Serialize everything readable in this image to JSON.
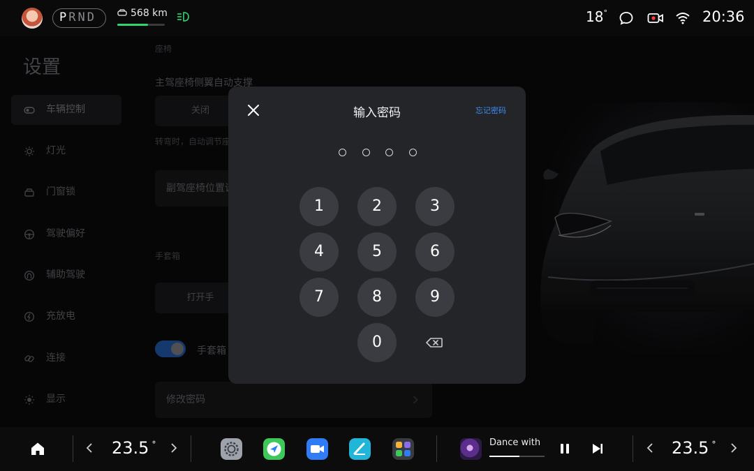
{
  "status_bar": {
    "gear": {
      "active": "P",
      "rest": "RND"
    },
    "range": "568 km",
    "range_level_percent": 65,
    "temperature": "18",
    "temperature_unit": "°",
    "time": "20:36",
    "icons": [
      "avatar",
      "car-icon",
      "headlight-icon",
      "message-icon",
      "camera-icon",
      "wifi-icon"
    ]
  },
  "settings": {
    "title": "设置",
    "nav": [
      {
        "label": "车辆控制",
        "icon": "car-control-icon",
        "active": true
      },
      {
        "label": "灯光",
        "icon": "light-icon"
      },
      {
        "label": "门窗锁",
        "icon": "door-lock-icon"
      },
      {
        "label": "驾驶偏好",
        "icon": "steering-wheel-icon"
      },
      {
        "label": "辅助驾驶",
        "icon": "assist-drive-icon"
      },
      {
        "label": "充放电",
        "icon": "charge-icon"
      },
      {
        "label": "连接",
        "icon": "link-icon"
      },
      {
        "label": "显示",
        "icon": "display-icon"
      }
    ],
    "section_seat": "座椅",
    "seat_support_title": "主驾座椅侧翼自动支撑",
    "seat_support_off": "关闭",
    "seat_support_hint": "转弯时，自动调节座",
    "copilot_seat_row": "副驾座椅位置调",
    "section_glovebox": "手套箱",
    "open_glovebox": "打开手",
    "glovebox_toggle_label": "手套箱",
    "change_password": "修改密码"
  },
  "dialog": {
    "title": "输入密码",
    "forgot": "忘记密码",
    "pin_length": 4,
    "keys": [
      "1",
      "2",
      "3",
      "4",
      "5",
      "6",
      "7",
      "8",
      "9",
      "0"
    ]
  },
  "dock": {
    "left_temp": "23.5",
    "right_temp": "23.5",
    "temp_unit": "°",
    "apps": [
      "settings-app-icon",
      "maps-app-icon",
      "video-call-app-icon",
      "notes-app-icon",
      "app-launcher-icon"
    ],
    "song_title": "Dance with",
    "song_progress_percent": 55
  },
  "colors": {
    "accent_blue": "#3f8cf4",
    "range_green": "#2fd46f",
    "dialog_bg": "#242529",
    "key_bg": "#3b3c42"
  }
}
